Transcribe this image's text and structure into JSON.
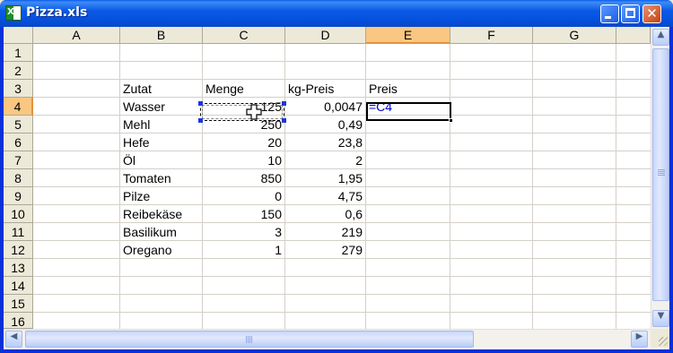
{
  "window": {
    "title": "Pizza.xls",
    "icon": "excel-icon",
    "controls": {
      "minimize": "minimize-icon",
      "maximize": "maximize-icon",
      "close": "close-icon"
    }
  },
  "sheet": {
    "columns": [
      "A",
      "B",
      "C",
      "D",
      "E",
      "F",
      "G"
    ],
    "rows": [
      "1",
      "2",
      "3",
      "4",
      "5",
      "6",
      "7",
      "8",
      "9",
      "10",
      "11",
      "12",
      "13",
      "14",
      "15",
      "16"
    ],
    "active_column": "E",
    "active_row": "4",
    "headers": {
      "zutat": "Zutat",
      "menge": "Menge",
      "kg_preis": "kg-Preis",
      "preis": "Preis"
    },
    "data_rows": [
      {
        "zutat": "Wasser",
        "menge": "125",
        "kg_preis": "0,0047",
        "preis": "=C4"
      },
      {
        "zutat": "Mehl",
        "menge": "250",
        "kg_preis": "0,49",
        "preis": ""
      },
      {
        "zutat": "Hefe",
        "menge": "20",
        "kg_preis": "23,8",
        "preis": ""
      },
      {
        "zutat": "Öl",
        "menge": "10",
        "kg_preis": "2",
        "preis": ""
      },
      {
        "zutat": "Tomaten",
        "menge": "850",
        "kg_preis": "1,95",
        "preis": ""
      },
      {
        "zutat": "Pilze",
        "menge": "0",
        "kg_preis": "4,75",
        "preis": ""
      },
      {
        "zutat": "Reibekäse",
        "menge": "150",
        "kg_preis": "0,6",
        "preis": ""
      },
      {
        "zutat": "Basilikum",
        "menge": "3",
        "kg_preis": "219",
        "preis": ""
      },
      {
        "zutat": "Oregano",
        "menge": "1",
        "kg_preis": "279",
        "preis": ""
      }
    ],
    "editing_cell": "E4",
    "referenced_cell": "C4"
  },
  "scrollbars": {
    "up": "arrow-up-icon",
    "down": "arrow-down-icon",
    "left": "arrow-left-icon",
    "right": "arrow-right-icon"
  },
  "colors": {
    "title_bar": "#0550DC",
    "active_header": "#F9C781",
    "formula_text": "#0000CC",
    "reference_handles": "#1C36D9"
  }
}
